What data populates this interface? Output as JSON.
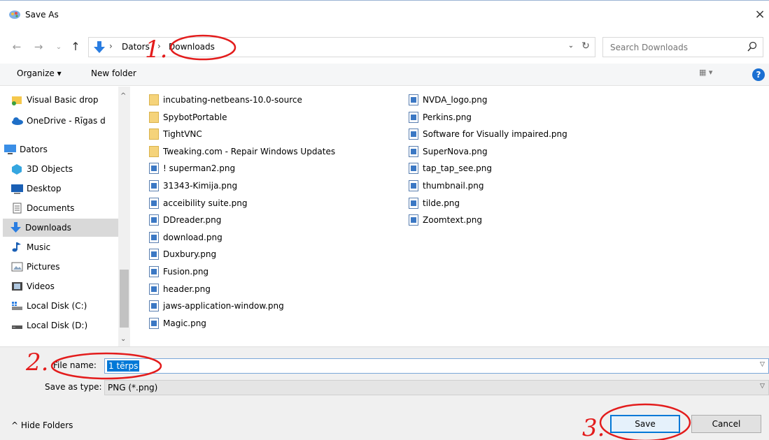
{
  "window": {
    "title": "Save As",
    "close_label": "×"
  },
  "address": {
    "crumbs": [
      "Dators",
      "Downloads"
    ],
    "separator": "›"
  },
  "search": {
    "placeholder": "Search Downloads"
  },
  "toolbar": {
    "organize_label": "Organize ▾",
    "new_folder_label": "New folder",
    "view_label": "▦ ▾",
    "help_label": "?"
  },
  "nav": {
    "items": [
      {
        "label": "Visual Basic drop",
        "icon": "folder-sync-icon"
      },
      {
        "label": "OneDrive - Rīgas d",
        "icon": "onedrive-cloud-icon"
      },
      {
        "label": "Dators",
        "icon": "computer-icon"
      },
      {
        "label": "3D Objects",
        "icon": "3d-objects-icon"
      },
      {
        "label": "Desktop",
        "icon": "desktop-icon"
      },
      {
        "label": "Documents",
        "icon": "documents-icon"
      },
      {
        "label": "Downloads",
        "icon": "downloads-icon",
        "selected": true
      },
      {
        "label": "Music",
        "icon": "music-icon"
      },
      {
        "label": "Pictures",
        "icon": "pictures-icon"
      },
      {
        "label": "Videos",
        "icon": "videos-icon"
      },
      {
        "label": "Local Disk (C:)",
        "icon": "windows-drive-icon"
      },
      {
        "label": "Local Disk (D:)",
        "icon": "drive-icon"
      }
    ]
  },
  "files": {
    "column1": [
      {
        "name": "incubating-netbeans-10.0-source",
        "type": "folder"
      },
      {
        "name": "SpybotPortable",
        "type": "folder"
      },
      {
        "name": "TightVNC",
        "type": "folder"
      },
      {
        "name": "Tweaking.com - Repair Windows Updates",
        "type": "folder"
      },
      {
        "name": "! superman2.png",
        "type": "png"
      },
      {
        "name": "31343-Kimija.png",
        "type": "png"
      },
      {
        "name": "acceibility suite.png",
        "type": "png"
      },
      {
        "name": "DDreader.png",
        "type": "png"
      },
      {
        "name": "download.png",
        "type": "png"
      },
      {
        "name": "Duxbury.png",
        "type": "png"
      },
      {
        "name": "Fusion.png",
        "type": "png"
      },
      {
        "name": "header.png",
        "type": "png"
      },
      {
        "name": "jaws-application-window.png",
        "type": "png"
      },
      {
        "name": "Magic.png",
        "type": "png"
      }
    ],
    "column2": [
      {
        "name": "NVDA_logo.png",
        "type": "png"
      },
      {
        "name": "Perkins.png",
        "type": "png"
      },
      {
        "name": "Software for Visually impaired.png",
        "type": "png"
      },
      {
        "name": "SuperNova.png",
        "type": "png"
      },
      {
        "name": "tap_tap_see.png",
        "type": "png"
      },
      {
        "name": "thumbnail.png",
        "type": "png"
      },
      {
        "name": "tilde.png",
        "type": "png"
      },
      {
        "name": "Zoomtext.png",
        "type": "png"
      }
    ]
  },
  "form": {
    "file_name_label": "File name:",
    "file_name_value": "1 tērps",
    "save_type_label": "Save as type:",
    "save_type_value": "PNG (*.png)"
  },
  "footer": {
    "hide_folders_label": "^  Hide Folders",
    "save_label": "Save",
    "cancel_label": "Cancel"
  },
  "annotations": {
    "one": "1.",
    "two": "2.",
    "three": "3.",
    "color": "#e31c1c"
  }
}
